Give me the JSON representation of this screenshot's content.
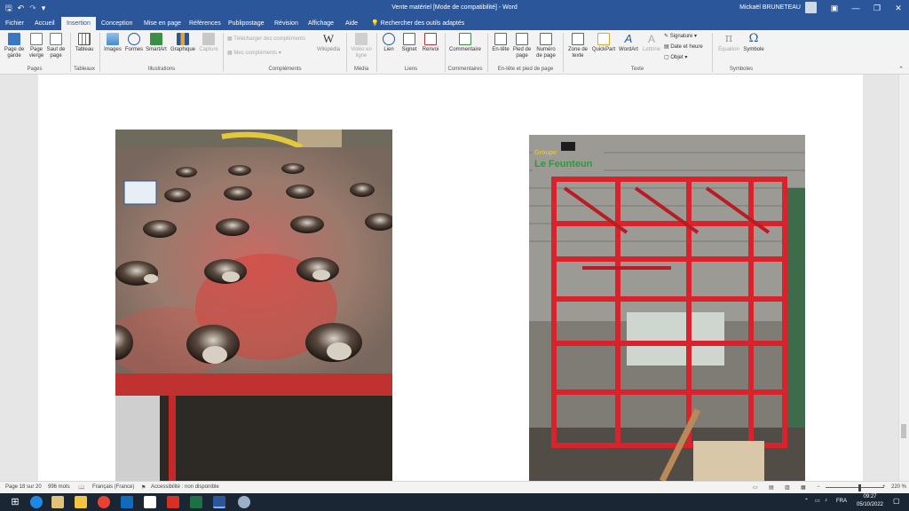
{
  "titlebar": {
    "doc_title": "Vente matériel [Mode de compatibilité] - Word",
    "user": "Mickaël BRUNETEAU",
    "qat": [
      "save-icon",
      "undo-icon",
      "redo-icon"
    ],
    "win": {
      "minimize": "—",
      "restore": "❐",
      "close": "✕",
      "ribbon_opts": "▣"
    }
  },
  "tabs": {
    "items": [
      "Fichier",
      "Accueil",
      "Insertion",
      "Conception",
      "Mise en page",
      "Références",
      "Publipostage",
      "Révision",
      "Affichage",
      "Aide"
    ],
    "active": "Insertion",
    "search": "Rechercher des outils adaptés"
  },
  "ribbon": {
    "pages": {
      "cover": "Page de garde",
      "blank": "Page vierge",
      "break": "Saut de page",
      "label": "Pages"
    },
    "tables": {
      "table": "Tableau",
      "label": "Tableaux"
    },
    "illustrations": {
      "images": "Images",
      "shapes": "Formes",
      "smartart": "SmartArt",
      "chart": "Graphique",
      "capture": "Capture",
      "label": "Illustrations"
    },
    "addins": {
      "get": "Télécharger des compléments",
      "mine": "Mes compléments",
      "wiki": "Wikipédia",
      "label": "Compléments"
    },
    "media": {
      "video": "Vidéo en ligne",
      "label": "Média"
    },
    "links": {
      "link": "Lien",
      "bookmark": "Signet",
      "xref": "Renvoi",
      "label": "Liens"
    },
    "comments": {
      "comment": "Commentaire",
      "label": "Commentaires"
    },
    "header_footer": {
      "header": "En-tête",
      "footer": "Pied de page",
      "number": "Numéro de page",
      "label": "En-tête et pied de page"
    },
    "text": {
      "textbox": "Zone de texte",
      "quickpart": "QuickPart",
      "wordart": "WordArt",
      "dropcap": "Lettrine",
      "signature": "Signature",
      "datetime": "Date et heure",
      "object": "Objet",
      "label": "Texte"
    },
    "symbols": {
      "equation": "Équation",
      "symbol": "Symbole",
      "label": "Symboles"
    }
  },
  "photos": {
    "right_logo_top": "Groupe",
    "right_logo_main": "Le Feunteun"
  },
  "status": {
    "page": "Page 18 sur 20",
    "words": "996 mots",
    "language": "Français (France)",
    "accessibility": "Accessibilité : non disponible",
    "zoom": "220 %"
  },
  "taskbar": {
    "lang": "FRA",
    "time": "09:27",
    "date": "05/10/2022"
  },
  "colors": {
    "word_blue": "#2b579a",
    "frame_red": "#d8222c",
    "taskbar": "#1b2634"
  }
}
